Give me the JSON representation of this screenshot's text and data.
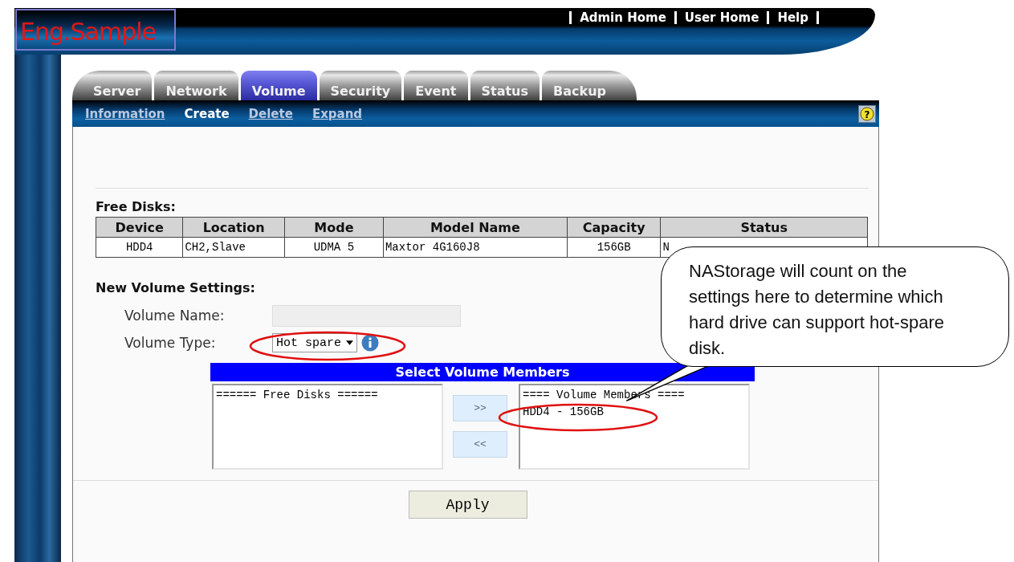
{
  "header": {
    "logo": "Eng.Sample",
    "links": [
      "Admin Home",
      "User Home",
      "Help"
    ]
  },
  "tabs": [
    {
      "label": "Server",
      "selected": false
    },
    {
      "label": "Network",
      "selected": false
    },
    {
      "label": "Volume",
      "selected": true
    },
    {
      "label": "Security",
      "selected": false
    },
    {
      "label": "Event",
      "selected": false
    },
    {
      "label": "Status",
      "selected": false
    },
    {
      "label": "Backup",
      "selected": false
    }
  ],
  "subnav": [
    {
      "label": "Information",
      "selected": false
    },
    {
      "label": "Create",
      "selected": true
    },
    {
      "label": "Delete",
      "selected": false
    },
    {
      "label": "Expand",
      "selected": false
    }
  ],
  "free_disks": {
    "title": "Free Disks:",
    "columns": [
      "Device",
      "Location",
      "Mode",
      "Model Name",
      "Capacity",
      "Status"
    ],
    "rows": [
      [
        "HDD4",
        "CH2,Slave",
        "UDMA 5",
        "Maxtor 4G160J8",
        "156GB",
        "N"
      ]
    ]
  },
  "settings": {
    "title": "New Volume Settings:",
    "volume_name": {
      "label": "Volume Name:"
    },
    "volume_type": {
      "label": "Volume Type:",
      "value": "Hot spare"
    }
  },
  "members": {
    "title": "Select Volume Members",
    "free_list": [
      "====== Free Disks ======"
    ],
    "add_button": ">>",
    "remove_button": "<<",
    "member_list": [
      "==== Volume Members ====",
      "HDD4 - 156GB"
    ]
  },
  "help_icon": "?",
  "apply_button": "Apply",
  "callout": "NAStorage will count on the settings here to determine which hard drive can support hot-spare disk."
}
